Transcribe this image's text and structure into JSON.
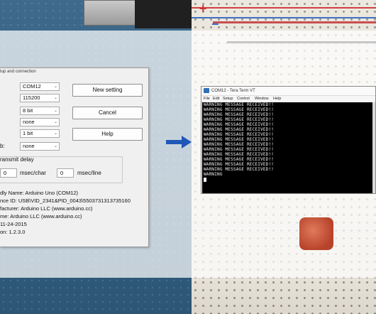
{
  "setup_dialog": {
    "title": "tup and connection",
    "fields": [
      {
        "label": "",
        "value": "COM12"
      },
      {
        "label": "",
        "value": "115200"
      },
      {
        "label": "",
        "value": "8 bit"
      },
      {
        "label": "",
        "value": "none"
      },
      {
        "label": "",
        "value": "1 bit"
      },
      {
        "label": "b:",
        "value": "none"
      }
    ],
    "buttons": {
      "new_setting": "New setting",
      "cancel": "Cancel",
      "help": "Help"
    },
    "transmit_delay": {
      "label": "ransmit delay",
      "char_value": "0",
      "char_unit": "msec/char",
      "line_value": "0",
      "line_unit": "msec/line"
    },
    "device_info": [
      "dly Name: Arduino Uno (COM12)",
      "nce ID: USB\\VID_2341&PID_0043\\5503731313735160",
      "facturer: Arduino LLC (www.arduino.cc)",
      "me: Arduino LLC (www.arduino.cc)",
      "11-24-2015",
      "on: 1.2.3.0"
    ]
  },
  "arrow": {
    "icon": "right-arrow-icon",
    "color": "#1f57b8"
  },
  "teraterm": {
    "title": "COM12 - Tera Term VT",
    "menu": [
      "File",
      "Edit",
      "Setup",
      "Control",
      "Window",
      "Help"
    ],
    "lines": [
      "WARNING MESSAGE RECEIVED!!",
      "WARNING MESSAGE RECEIVED!!",
      "WARNING MESSAGE RECEIVED!!",
      "WARNING MESSAGE RECEIVED!!",
      "WARNING MESSAGE RECEIVED!!",
      "WARNING MESSAGE RECEIVED!!",
      "WARNING MESSAGE RECEIVED!!",
      "WARNING MESSAGE RECEIVED!!",
      "WARNING MESSAGE RECEIVED!!",
      "WARNING MESSAGE RECEIVED!!",
      "WARNING MESSAGE RECEIVED!!",
      "WARNING MESSAGE RECEIVED!!",
      "WARNING MESSAGE RECEIVED!!",
      "WARNING MESSAGE RECEIVED!!",
      "WARNING"
    ]
  }
}
